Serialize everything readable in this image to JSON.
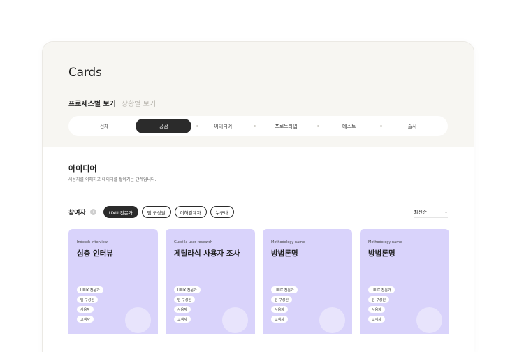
{
  "page": {
    "title": "Cards"
  },
  "view_toggle": {
    "active": "프로세스별 보기",
    "inactive": "상황별 보기"
  },
  "steps": [
    "전체",
    "공감",
    "아이디어",
    "프로토타입",
    "테스트",
    "출시"
  ],
  "active_step": 1,
  "section": {
    "title": "아이디어",
    "description": "사용자를 이해하고 데이터를 쌓아가는 단계입니다."
  },
  "filters": {
    "label": "참여자",
    "info_icon": "i",
    "chips": [
      "UXUI전문가",
      "팀 구성원",
      "이해관계자",
      "누구나"
    ],
    "active_chip": 0
  },
  "sort": {
    "label": "최신순",
    "chevron": "⌄"
  },
  "cards": [
    {
      "subtitle": "Indepth interview",
      "title": "심층 인터뷰",
      "tags": [
        "UIUX 전문가",
        "팀 구성원",
        "사용자",
        "고객사"
      ]
    },
    {
      "subtitle": "Guerilla user research",
      "title": "게릴라식 사용자 조사",
      "tags": [
        "UIUX 전문가",
        "팀 구성원",
        "사용자",
        "고객사"
      ]
    },
    {
      "subtitle": "Methodology name",
      "title": "방법론명",
      "tags": [
        "UIUX 전문가",
        "팀 구성원",
        "사용자",
        "고객사"
      ]
    },
    {
      "subtitle": "Methodology name",
      "title": "방법론명",
      "tags": [
        "UIUX 전문가",
        "팀 구성원",
        "사용자",
        "고객사"
      ]
    }
  ],
  "colors": {
    "card_bg": "#d9d3fb",
    "header_bg": "#f7f6f2",
    "active_dark": "#2b2b2b"
  }
}
